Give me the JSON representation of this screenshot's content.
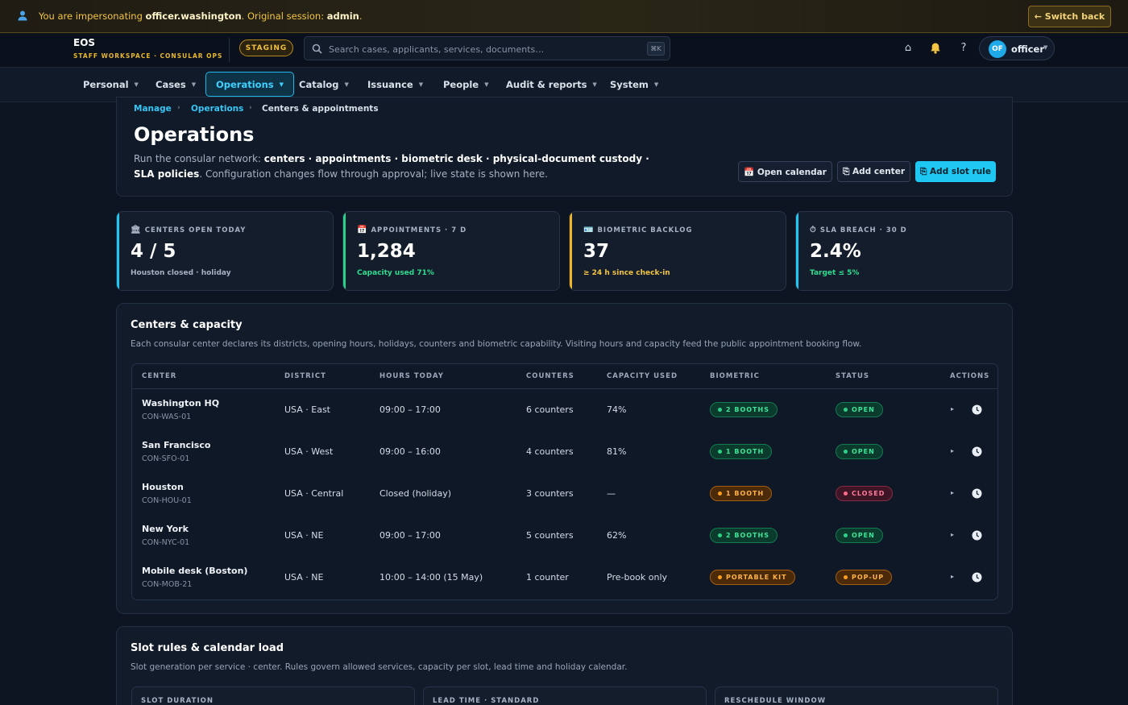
{
  "banner": {
    "prefix": "You are impersonating ",
    "impersonated_user": "officer.washington",
    "middle": ". Original session: ",
    "original_user": "admin",
    "suffix": ".",
    "switch_back": "← Switch back"
  },
  "brand": {
    "title": "EOS",
    "subtitle": "STAFF WORKSPACE · CONSULAR OPS"
  },
  "env_badge": "STAGING",
  "search": {
    "placeholder": "Search cases, applicants, services, documents…",
    "shortcut": "⌘K"
  },
  "topbar_icons": {
    "home": "⌂",
    "help": "?"
  },
  "user": {
    "initials": "OF",
    "name": "officer"
  },
  "nav": {
    "items": [
      {
        "label": "Personal"
      },
      {
        "label": "Cases"
      },
      {
        "label": "Operations",
        "active": true
      },
      {
        "label": "Catalog"
      },
      {
        "label": "Issuance"
      },
      {
        "label": "People"
      },
      {
        "label": "Audit & reports"
      },
      {
        "label": "System"
      }
    ]
  },
  "breadcrumb": {
    "items": [
      "Manage",
      "Operations",
      "Centers & appointments"
    ],
    "separator": "›"
  },
  "page": {
    "title": "Operations",
    "desc_prefix": "Run the consular network: ",
    "desc_bold": "centers · appointments · biometric desk · physical-document custody · SLA policies",
    "desc_suffix": ". Configuration changes flow through approval; live state is shown here.",
    "buttons": {
      "open_calendar": "📅 Open calendar",
      "add_center": "⎘ Add center",
      "add_slot_rule": "⎘ Add slot rule"
    }
  },
  "kpis": [
    {
      "icon": "🏛",
      "label": "CENTERS OPEN TODAY",
      "value": "4 / 5",
      "note": "Houston closed · holiday",
      "accent": "#1ec8f3",
      "note_color": "#a6b2c3"
    },
    {
      "icon": "📅",
      "label": "APPOINTMENTS · 7 D",
      "value": "1,284",
      "note": "Capacity used 71%",
      "accent": "#27d38a",
      "note_color": "#2fdc8f"
    },
    {
      "icon": "🪪",
      "label": "BIOMETRIC BACKLOG",
      "value": "37",
      "note": "≥ 24 h since check-in",
      "accent": "#f0b429",
      "note_color": "#f4c542"
    },
    {
      "icon": "⏱",
      "label": "SLA BREACH · 30 D",
      "value": "2.4%",
      "note": "Target ≤ 5%",
      "accent": "#1ec8f3",
      "note_color": "#2fdc8f"
    }
  ],
  "centers": {
    "title": "Centers & capacity",
    "description": "Each consular center declares its districts, opening hours, holidays, counters and biometric capability. Visiting hours and capacity feed the public appointment booking flow.",
    "columns": [
      "CENTER",
      "DISTRICT",
      "HOURS TODAY",
      "COUNTERS",
      "CAPACITY USED",
      "BIOMETRIC",
      "STATUS",
      "ACTIONS"
    ],
    "rows": [
      {
        "name": "Washington HQ",
        "code": "CON-WAS-01",
        "district": "USA · East",
        "hours": "09:00 – 17:00",
        "counters": "6 counters",
        "capacity": "74%",
        "biometric": "2 BOOTHS",
        "bio_tone": "green",
        "status": "OPEN",
        "status_tone": "green"
      },
      {
        "name": "San Francisco",
        "code": "CON-SFO-01",
        "district": "USA · West",
        "hours": "09:00 – 16:00",
        "counters": "4 counters",
        "capacity": "81%",
        "biometric": "1 BOOTH",
        "bio_tone": "green",
        "status": "OPEN",
        "status_tone": "green"
      },
      {
        "name": "Houston",
        "code": "CON-HOU-01",
        "district": "USA · Central",
        "hours": "Closed (holiday)",
        "counters": "3 counters",
        "capacity": "—",
        "biometric": "1 BOOTH",
        "bio_tone": "orange",
        "status": "CLOSED",
        "status_tone": "red"
      },
      {
        "name": "New York",
        "code": "CON-NYC-01",
        "district": "USA · NE",
        "hours": "09:00 – 17:00",
        "counters": "5 counters",
        "capacity": "62%",
        "biometric": "2 BOOTHS",
        "bio_tone": "green",
        "status": "OPEN",
        "status_tone": "green"
      },
      {
        "name": "Mobile desk (Boston)",
        "code": "CON-MOB-21",
        "district": "USA · NE",
        "hours": "10:00 – 14:00 (15 May)",
        "counters": "1 counter",
        "capacity": "Pre-book only",
        "biometric": "PORTABLE KIT",
        "bio_tone": "orange",
        "status": "POP-UP",
        "status_tone": "orange"
      }
    ],
    "row_actions": {
      "run": "▸"
    }
  },
  "slot_rules": {
    "title": "Slot rules & calendar load",
    "description": "Slot generation per service · center. Rules govern allowed services, capacity per slot, lead time and holiday calendar.",
    "cards": [
      "SLOT DURATION",
      "LEAD TIME · STANDARD",
      "RESCHEDULE WINDOW"
    ]
  },
  "colors": {
    "accent": "#1ec8f3",
    "warning": "#f4c542",
    "success": "#2fdc8f",
    "danger": "#ff6d8c"
  }
}
